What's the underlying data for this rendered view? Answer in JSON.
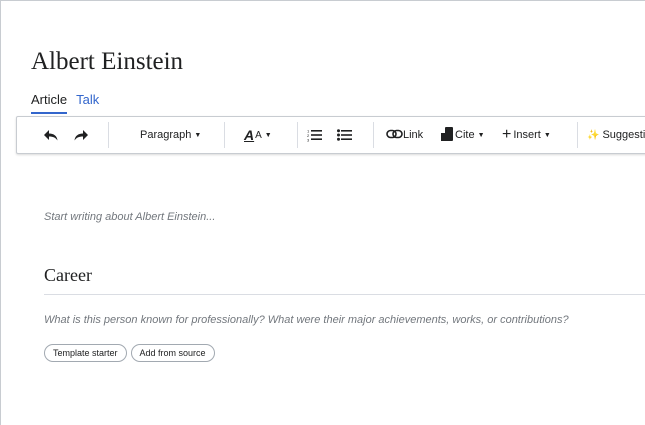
{
  "page": {
    "title": "Albert Einstein"
  },
  "tabs": [
    {
      "label": "Article",
      "active": true
    },
    {
      "label": "Talk",
      "active": false
    }
  ],
  "toolbar": {
    "undo_icon": "undo-arrow-icon",
    "redo_icon": "redo-arrow-icon",
    "paragraph_label": "Paragraph",
    "text_style_glyph": "A",
    "text_style_small": "A",
    "numbered_list_icon": "numbered-list-icon",
    "bullet_list_icon": "bullet-list-icon",
    "link_label": "Link",
    "cite_label": "Cite",
    "insert_label": "Insert",
    "suggestions_label": "Suggestio",
    "caret": "▼",
    "plus": "+",
    "sparkle": "✨"
  },
  "editor": {
    "intro_placeholder": "Start writing about Albert Einstein...",
    "sections": [
      {
        "heading": "Career",
        "prompt": "What is this person known for professionally? What were their major achievements, works, or contributions?",
        "chips": [
          "Template starter",
          "Add from source"
        ]
      }
    ]
  },
  "colors": {
    "link": "#3366cc",
    "text": "#202122",
    "placeholder": "#72777d",
    "border": "#c8ccd1"
  }
}
